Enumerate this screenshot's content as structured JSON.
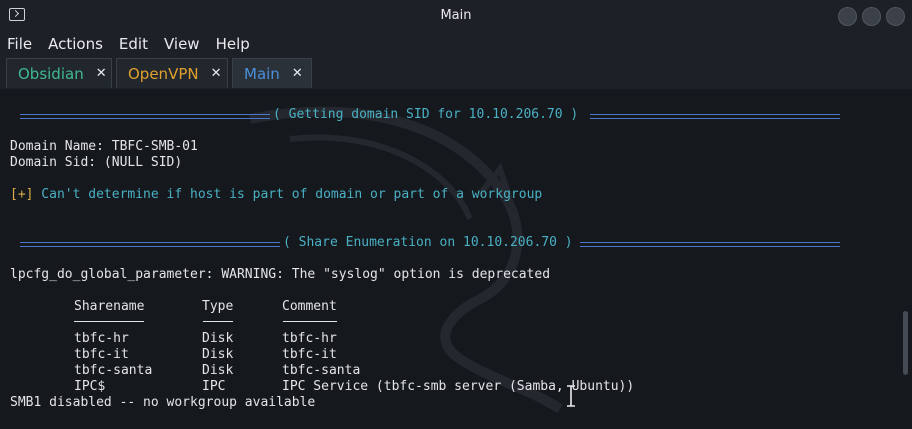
{
  "window": {
    "title": "Main"
  },
  "menu": [
    "File",
    "Actions",
    "Edit",
    "View",
    "Help"
  ],
  "tabs": [
    {
      "label": "Obsidian",
      "color": "#3fb98f"
    },
    {
      "label": "OpenVPN",
      "color": "#e0a12c"
    },
    {
      "label": "Main",
      "color": "#4a90d9"
    }
  ],
  "terminal": {
    "header1": "( Getting domain SID for 10.10.206.70 )",
    "domain_name": "Domain Name: TBFC-SMB-01",
    "domain_sid": "Domain Sid: (NULL SID)",
    "plus": "[+]",
    "warn_msg": " Can't determine if host is part of domain or part of a workgroup",
    "header2": "( Share Enumeration on 10.10.206.70 )",
    "lpcfg": "lpcfg_do_global_parameter: WARNING: The \"syslog\" option is deprecated",
    "columns": [
      "Sharename",
      "Type",
      "Comment"
    ],
    "shares": [
      {
        "name": "tbfc-hr",
        "type": "Disk",
        "comment": "tbfc-hr"
      },
      {
        "name": "tbfc-it",
        "type": "Disk",
        "comment": "tbfc-it"
      },
      {
        "name": "tbfc-santa",
        "type": "Disk",
        "comment": "tbfc-santa"
      },
      {
        "name": "IPC$",
        "type": "IPC",
        "comment": "IPC Service (tbfc-smb server (Samba, Ubuntu))"
      }
    ],
    "smb1": "SMB1 disabled -- no workgroup available"
  }
}
